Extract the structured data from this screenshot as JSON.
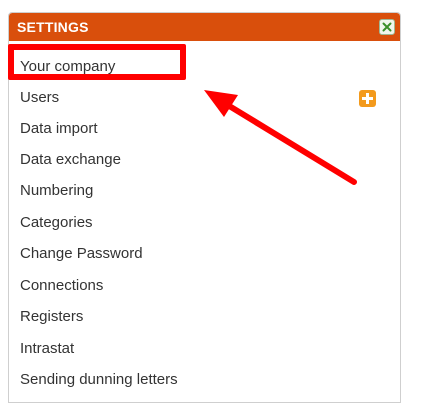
{
  "settings": {
    "title": "SETTINGS",
    "close_icon": "close-icon",
    "add_icon": "plus-icon",
    "accent_color": "#d94f0c",
    "items": [
      "Your company",
      "Users",
      "Data import",
      "Data exchange",
      "Numbering",
      "Categories",
      "Change Password",
      "Connections",
      "Registers",
      "Intrastat",
      "Sending dunning letters"
    ]
  },
  "annotation": {
    "color": "#ff0000",
    "highlighted_item": "Your company"
  }
}
